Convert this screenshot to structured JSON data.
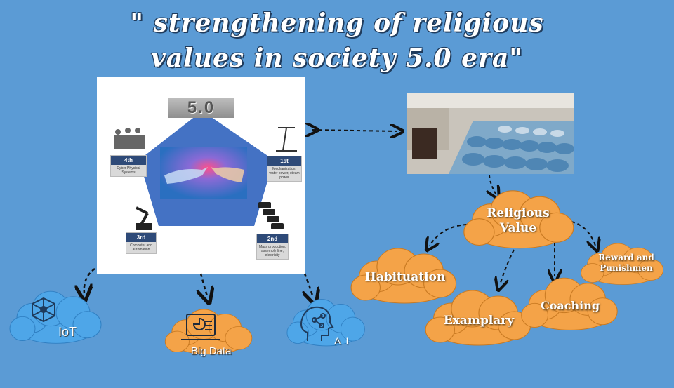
{
  "title": {
    "line1": "\" strengthening of religious",
    "line2": "values in society 5.0 era\""
  },
  "society_panel": {
    "badge": "5.0",
    "stages": [
      {
        "label": "4th",
        "desc": "Cyber Physical Systems"
      },
      {
        "label": "1st",
        "desc": "Mechanization, water power, steam power"
      },
      {
        "label": "3rd",
        "desc": "Computer and automation"
      },
      {
        "label": "2nd",
        "desc": "Mass production, assembly line, electricity"
      }
    ]
  },
  "tech_clouds": [
    {
      "label": "IoT"
    },
    {
      "label": "Big Data"
    },
    {
      "label": "A I"
    }
  ],
  "religious_value": {
    "center": "Religious Value",
    "methods": [
      {
        "label": "Habituation"
      },
      {
        "label": "Examplary"
      },
      {
        "label": "Coaching"
      },
      {
        "label": "Reward and Punishmen"
      }
    ]
  },
  "colors": {
    "background": "#5b9bd5",
    "orange_cloud": "#f4a348",
    "blue_cloud": "#4ea6e8",
    "pentagon": "#4472c4"
  }
}
